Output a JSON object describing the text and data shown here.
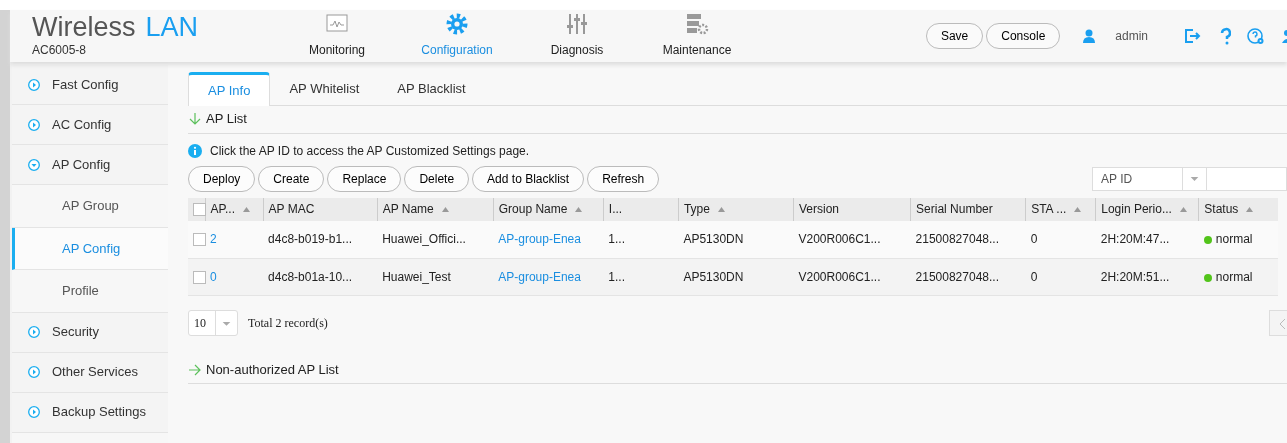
{
  "header": {
    "title": "Wireless",
    "title_accent": "LAN",
    "subtitle": "AC6005-8",
    "nav": [
      {
        "kind": "monitor",
        "label": "Monitoring",
        "selected": false
      },
      {
        "kind": "gear",
        "label": "Configuration",
        "selected": true
      },
      {
        "kind": "sliders",
        "label": "Diagnosis",
        "selected": false
      },
      {
        "kind": "server",
        "label": "Maintenance",
        "selected": false
      }
    ],
    "buttons": [
      "Save",
      "Console"
    ],
    "user": "admin",
    "tools": [
      {
        "kind": "logout"
      },
      {
        "kind": "help"
      },
      {
        "kind": "help-gear"
      },
      {
        "kind": "cut"
      }
    ]
  },
  "sidebar": {
    "items": [
      {
        "label": "Fast Config",
        "expanded": false
      },
      {
        "label": "AC Config",
        "expanded": false
      },
      {
        "label": "AP Config",
        "expanded": true,
        "children": [
          {
            "label": "AP Group",
            "selected": false
          },
          {
            "label": "AP Config",
            "selected": true
          },
          {
            "label": "Profile",
            "selected": false
          }
        ]
      },
      {
        "label": "Security",
        "expanded": false
      },
      {
        "label": "Other Services",
        "expanded": false
      },
      {
        "label": "Backup Settings",
        "expanded": false
      }
    ]
  },
  "tabs": [
    {
      "label": "AP Info",
      "selected": true
    },
    {
      "label": "AP Whitelist",
      "selected": false
    },
    {
      "label": "AP Blacklist",
      "selected": false
    }
  ],
  "sections": [
    {
      "title": "AP List",
      "expanded": true
    },
    {
      "title": "Non-authorized AP List",
      "expanded": false
    }
  ],
  "info": "Click the AP ID to access the AP Customized Settings page.",
  "actions": [
    "Deploy",
    "Create",
    "Replace",
    "Delete",
    "Add to Blacklist",
    "Refresh"
  ],
  "search": {
    "field": "AP ID"
  },
  "table": {
    "select_all_checked": false,
    "columns": [
      {
        "label": "AP...",
        "sortable": true
      },
      {
        "label": "AP MAC",
        "sortable": false
      },
      {
        "label": "AP Name",
        "sortable": true
      },
      {
        "label": "Group Name",
        "sortable": true
      },
      {
        "label": "I...",
        "sortable": false
      },
      {
        "label": "Type",
        "sortable": true
      },
      {
        "label": "Version",
        "sortable": false
      },
      {
        "label": "Serial Number",
        "sortable": false
      },
      {
        "label": "STA ...",
        "sortable": true
      },
      {
        "label": "Login Perio...",
        "sortable": true
      },
      {
        "label": "Status",
        "sortable": true
      }
    ],
    "rows": [
      {
        "checked": false,
        "ap_id": "2",
        "mac": "d4c8-b019-b1...",
        "name": "Huawei_Offici...",
        "group": "AP-group-Enea",
        "column_5": "1...",
        "type": "AP5130DN",
        "version": "V200R006C1...",
        "serial": "21500827048...",
        "sta": "0",
        "login": "2H:20M:47...",
        "status": "normal",
        "color": "#52c41a"
      },
      {
        "checked": false,
        "ap_id": "0",
        "mac": "d4c8-b01a-10...",
        "name": "Huawei_Test",
        "group": "AP-group-Enea",
        "column_5": "1...",
        "type": "AP5130DN",
        "version": "V200R006C1...",
        "serial": "21500827048...",
        "sta": "0",
        "login": "2H:20M:51...",
        "status": "normal",
        "color": "#52c41a"
      }
    ]
  },
  "pager": {
    "page_size": "10",
    "total": "Total 2 record(s)"
  }
}
